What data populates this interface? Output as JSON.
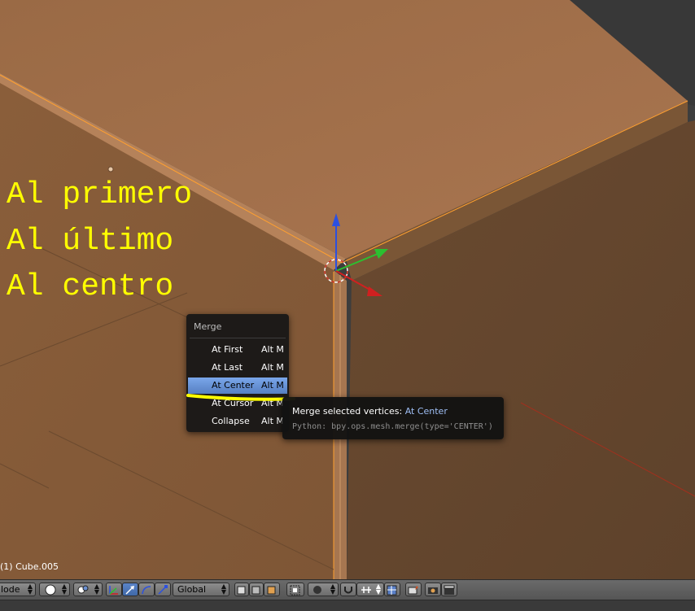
{
  "overlay_lines": [
    "Al primero",
    "Al último",
    "Al centro"
  ],
  "object_info": "(1) Cube.005",
  "merge_menu": {
    "title": "Merge",
    "items": [
      {
        "label": "At First",
        "shortcut": "Alt M",
        "active": false
      },
      {
        "label": "At Last",
        "shortcut": "Alt M",
        "active": false
      },
      {
        "label": "At Center",
        "shortcut": "Alt M",
        "active": true
      },
      {
        "label": "At Cursor",
        "shortcut": "Alt M",
        "active": false
      },
      {
        "label": "Collapse",
        "shortcut": "Alt M",
        "active": false
      }
    ]
  },
  "tooltip": {
    "title": "Merge selected vertices:",
    "value": "At Center",
    "python": "Python: bpy.ops.mesh.merge(type='CENTER')"
  },
  "header": {
    "mode_label": "lode",
    "transform_orientation": "Global"
  },
  "colors": {
    "accent": "#5680c2",
    "highlight_stroke": "#ffff00",
    "overlay_text": "#ffff00",
    "face_top": "#a3704a",
    "face_left": "#8a5e3a",
    "face_right": "#6b4a30"
  }
}
